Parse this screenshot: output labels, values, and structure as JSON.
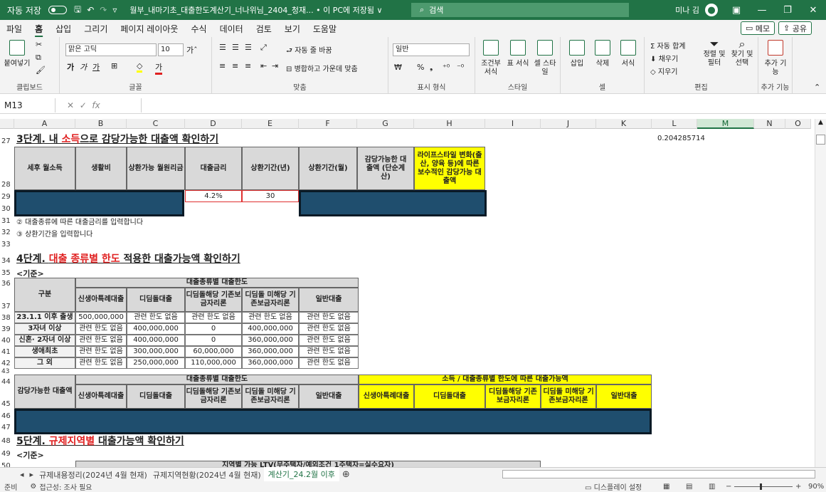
{
  "title": {
    "autosave": "자동 저장",
    "toggle": "끔",
    "filename": "월부_내마기초_대출한도계산기_너나위님_2404_청재... • 이 PC에 저장됨 ∨",
    "search": "검색",
    "user": "미나 김"
  },
  "menu": {
    "items": [
      "파일",
      "홈",
      "삽입",
      "그리기",
      "페이지 레이아웃",
      "수식",
      "데이터",
      "검토",
      "보기",
      "도움말"
    ],
    "memo": "메모",
    "share": "공유"
  },
  "ribbon": {
    "clipboard": {
      "paste": "붙여넣기",
      "label": "클립보드"
    },
    "font": {
      "name": "맑은 고딕",
      "size": "10",
      "label": "글꼴",
      "bold": "가",
      "italic": "가",
      "underline": "가"
    },
    "align": {
      "wrap": "자동 줄 바꿈",
      "merge": "병합하고 가운데 맞춤",
      "label": "맞춤"
    },
    "number": {
      "format": "일반",
      "label": "표시 형식",
      "pct": "%"
    },
    "style": {
      "cond": "조건부 서식",
      "table": "표 서식",
      "cell": "셀 스타일",
      "label": "스타일"
    },
    "cells": {
      "insert": "삽입",
      "delete": "삭제",
      "format": "서식",
      "label": "셀"
    },
    "edit": {
      "autosum": "자동 합계",
      "fill": "채우기",
      "clear": "지우기",
      "sort": "정렬 및 필터",
      "find": "찾기 및 선택",
      "label": "편집"
    },
    "addin": {
      "add": "추가 기능",
      "label": "추가 기능"
    }
  },
  "formula": {
    "namebox": "M13",
    "fx": "fx",
    "value": ""
  },
  "columns": [
    "A",
    "B",
    "C",
    "D",
    "E",
    "F",
    "G",
    "H",
    "I",
    "J",
    "K",
    "L",
    "M",
    "N",
    "O"
  ],
  "rows": {
    "r27": "27",
    "r28": "28",
    "r29": "29",
    "r30": "30",
    "r31": "31",
    "r32": "32",
    "r33": "33",
    "r34": "34",
    "r35": "35",
    "r36": "36",
    "r37": "37",
    "r38": "38",
    "r39": "39",
    "r40": "40",
    "r41": "41",
    "r42": "42",
    "r43": "43",
    "r44": "44",
    "r45": "45",
    "r46": "46",
    "r47": "47",
    "r48": "48",
    "r49": "49",
    "r50": "50"
  },
  "step3": {
    "title_a": "3단계. 내 ",
    "title_b": "소득",
    "title_c": "으로 감당가능한 대출액 확인하기",
    "l_value": "0.204285714",
    "headers": [
      "세후 월소득",
      "생활비",
      "상환가능 월원리금",
      "대출금리",
      "상환기간(년)",
      "상환기간(월)",
      "감당가능한 대출액 (단순계산)",
      "라이프스타일 변화(출산, 양육 등)에 따른 보수적인 감당가능 대출액"
    ],
    "rate": "4.2%",
    "years": "30",
    "note2": "② 대출종류에 따른 대출금리를 입력합니다",
    "note3": "③ 상환기간을 입력합니다"
  },
  "step4": {
    "title_a": "4단계. ",
    "title_b": "대출 종류별 한도",
    "title_c": " 적용한 대출가능액 확인하기",
    "criteria": "<기준>",
    "group": "구분",
    "limit_hdr": "대출종류별 대출한도",
    "cols": [
      "신생아특례대출",
      "디딤돌대출",
      "디딤돌해당 기존보금자리론",
      "디딤돌 미해당 기존보금자리론",
      "일반대출"
    ],
    "rows": [
      {
        "label": "23.1.1 이후 출생",
        "v": [
          "500,000,000",
          "관련 한도 없음",
          "관련 한도 없음",
          "관련 한도 없음",
          "관련 한도 없음"
        ]
      },
      {
        "label": "3자녀 이상",
        "v": [
          "관련 한도 없음",
          "400,000,000",
          "0",
          "400,000,000",
          "관련 한도 없음"
        ]
      },
      {
        "label": "신혼· 2자녀 이상",
        "v": [
          "관련 한도 없음",
          "400,000,000",
          "0",
          "360,000,000",
          "관련 한도 없음"
        ]
      },
      {
        "label": "생애최초",
        "v": [
          "관련 한도 없음",
          "300,000,000",
          "60,000,000",
          "360,000,000",
          "관련 한도 없음"
        ]
      },
      {
        "label": "그 외",
        "v": [
          "관련 한도 없음",
          "250,000,000",
          "110,000,000",
          "360,000,000",
          "관련 한도 없음"
        ]
      }
    ],
    "afford": "감당가능한 대출액",
    "result_hdr": "소득 / 대출종류별 한도에 따른 대출가능액"
  },
  "step5": {
    "title_a": "5단계. ",
    "title_b": "규제지역별",
    "title_c": " 대출가능액 확인하기",
    "criteria": "<기준>",
    "ltv": "지역별 가능 LTV(무주택자/예외조건 1주택자=실수요자)"
  },
  "tabs": [
    "규제내용정리(2024년 4월 현재)",
    "규제지역현황(2024년 4월 현재)",
    "계산기_24.2월 이후"
  ],
  "status": {
    "ready": "준비",
    "access": "접근성: 조사 필요",
    "display": "디스플레이 설정",
    "zoom": "90%"
  }
}
